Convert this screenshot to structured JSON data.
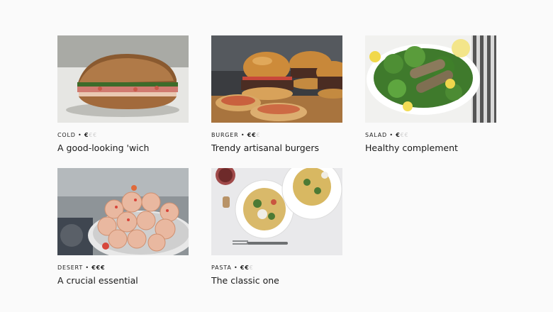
{
  "cards": [
    {
      "category": "COLD",
      "separator": "•",
      "price_active": "€",
      "price_inactive": "€€",
      "title": "A good-looking 'wich",
      "icon": "sandwich-photo"
    },
    {
      "category": "BURGER",
      "separator": "•",
      "price_active": "€€",
      "price_inactive": "€",
      "title": "Trendy artisanal burgers",
      "icon": "burgers-photo"
    },
    {
      "category": "SALAD",
      "separator": "•",
      "price_active": "€",
      "price_inactive": "€€",
      "title": "Healthy complement",
      "icon": "salad-photo"
    },
    {
      "category": "DESERT",
      "separator": "•",
      "price_active": "€€€",
      "price_inactive": "",
      "title": "A crucial essential",
      "icon": "macarons-photo"
    },
    {
      "category": "PASTA",
      "separator": "•",
      "price_active": "€€",
      "price_inactive": "€",
      "title": "The classic one",
      "icon": "pasta-photo"
    }
  ],
  "colors": {
    "background": "#fafafa",
    "text": "#1a1a1a",
    "price_inactive": "#cfcfcf"
  }
}
